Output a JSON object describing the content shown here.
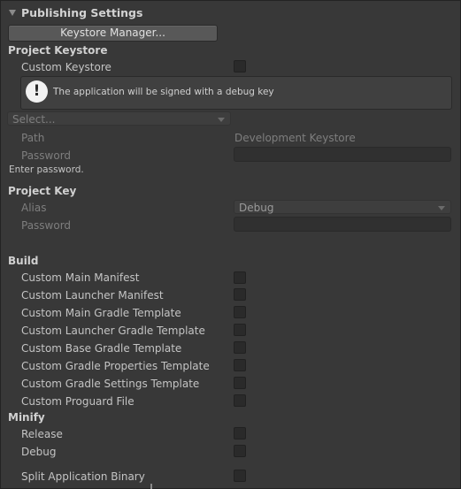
{
  "header": {
    "title": "Publishing Settings"
  },
  "keystore_manager_button": "Keystore Manager...",
  "project_keystore": {
    "title": "Project Keystore",
    "custom_keystore_label": "Custom Keystore",
    "custom_keystore_checked": false,
    "help_text": "The application will be signed with a debug key",
    "select_value": "Select...",
    "path_label": "Path",
    "path_value": "Development Keystore",
    "password_label": "Password",
    "enter_password_hint": "Enter password."
  },
  "project_key": {
    "title": "Project Key",
    "alias_label": "Alias",
    "alias_value": "Debug",
    "password_label": "Password"
  },
  "build": {
    "title": "Build",
    "items": [
      {
        "label": "Custom Main Manifest",
        "checked": false
      },
      {
        "label": "Custom Launcher Manifest",
        "checked": false
      },
      {
        "label": "Custom Main Gradle Template",
        "checked": false
      },
      {
        "label": "Custom Launcher Gradle Template",
        "checked": false
      },
      {
        "label": "Custom Base Gradle Template",
        "checked": false
      },
      {
        "label": "Custom Gradle Properties Template",
        "checked": false
      },
      {
        "label": "Custom Gradle Settings Template",
        "checked": false
      },
      {
        "label": "Custom Proguard File",
        "checked": false
      }
    ]
  },
  "minify": {
    "title": "Minify",
    "items": [
      {
        "label": "Release",
        "checked": false
      },
      {
        "label": "Debug",
        "checked": false
      }
    ]
  },
  "split_binary": {
    "label": "Split Application Binary",
    "checked": false
  }
}
